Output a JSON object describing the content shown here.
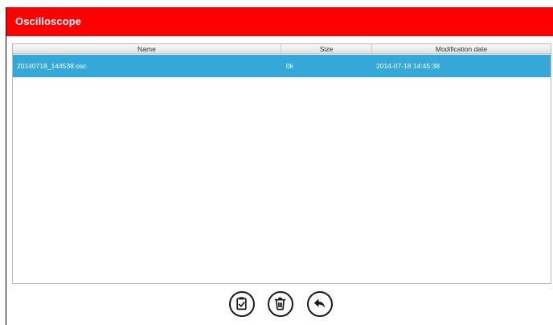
{
  "app": {
    "title": "Oscilloscope"
  },
  "table": {
    "columns": [
      "Name",
      "Size",
      "Modification date"
    ],
    "rows": [
      {
        "name": "20140718_144538.osc",
        "size": "0k",
        "modified": "2014-07-18 14:45:38",
        "selected": true
      }
    ]
  },
  "toolbar": {
    "buttons": [
      {
        "icon": "clipboard-check-icon",
        "action": "save"
      },
      {
        "icon": "trash-icon",
        "action": "delete"
      },
      {
        "icon": "back-arrow-icon",
        "action": "back"
      }
    ]
  },
  "colors": {
    "title_bar": "#fe0000",
    "selected_row": "#34a9d9",
    "title_text": "#ffffff"
  }
}
